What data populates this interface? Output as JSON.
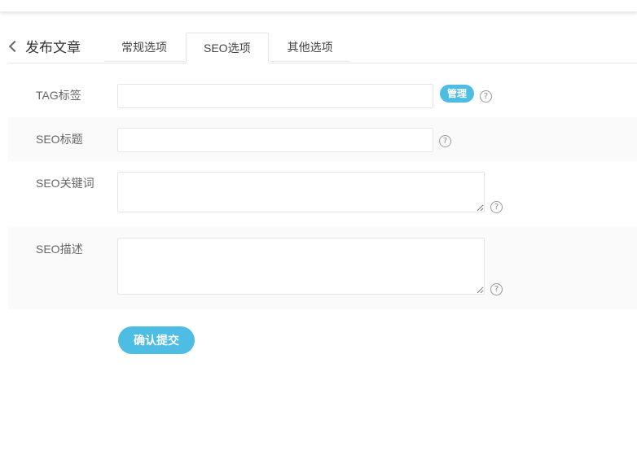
{
  "header": {
    "back_title": "发布文章",
    "tabs": [
      {
        "label": "常规选项",
        "active": false
      },
      {
        "label": "SEO选项",
        "active": true
      },
      {
        "label": "其他选项",
        "active": false
      }
    ]
  },
  "form": {
    "tag": {
      "label": "TAG标签",
      "value": "",
      "manage_label": "管理",
      "help": "?"
    },
    "seo_title": {
      "label": "SEO标题",
      "value": "",
      "help": "?"
    },
    "seo_keywords": {
      "label": "SEO关键词",
      "value": "",
      "help": "?"
    },
    "seo_description": {
      "label": "SEO描述",
      "value": "",
      "help": "?"
    },
    "submit_label": "确认提交"
  },
  "colors": {
    "accent": "#4dbde4",
    "alt_row": "#fafafa",
    "border": "#e6e6e6"
  },
  "icons": {
    "back": "chevron-left-icon",
    "help": "question-circle-icon"
  }
}
